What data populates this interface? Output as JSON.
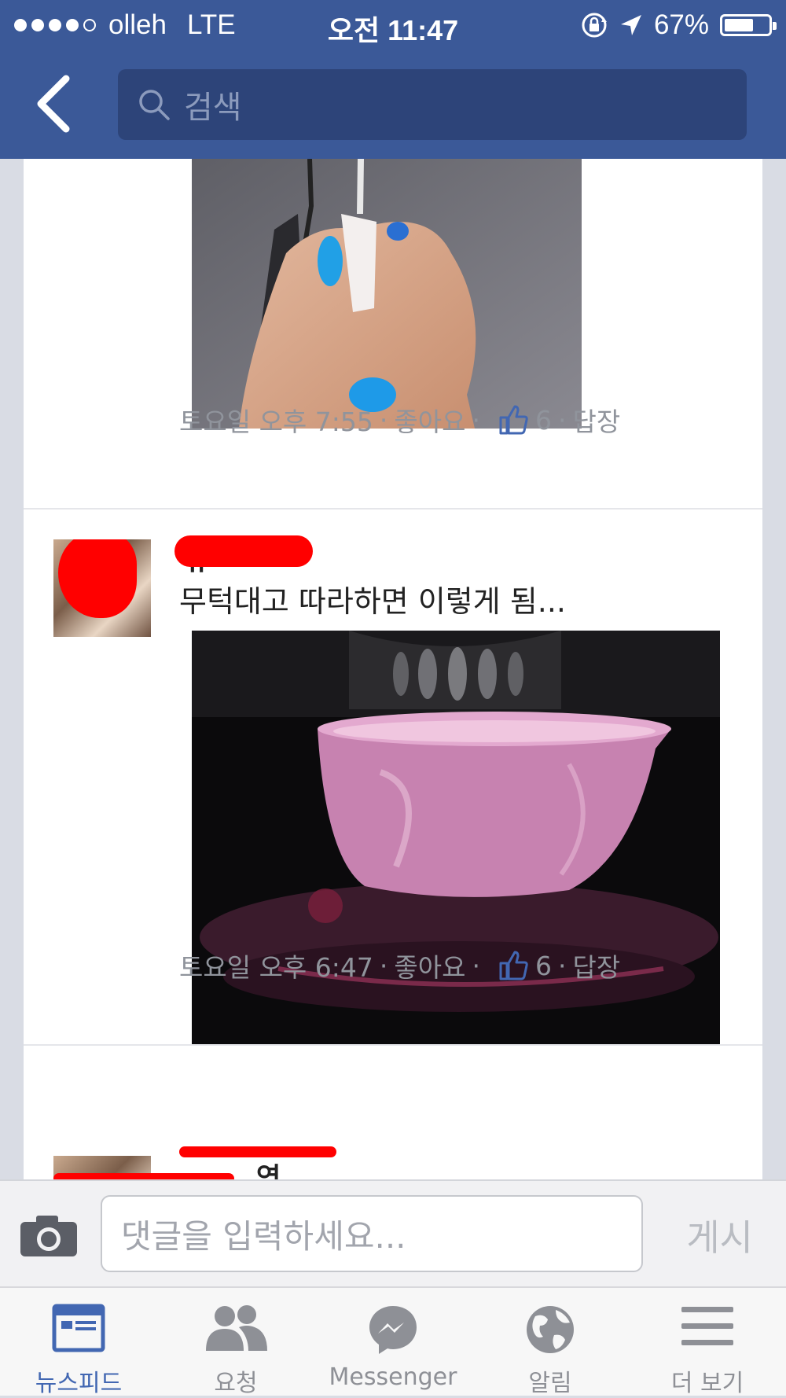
{
  "status": {
    "carrier": "olleh",
    "network": "LTE",
    "time": "오전 11:47",
    "battery": "67%",
    "battery_level": 0.67
  },
  "search": {
    "placeholder": "검색"
  },
  "comments": [
    {
      "time": "토요일 오후 7:55",
      "like_label": "좋아요",
      "like_count": "6",
      "reply_label": "답장"
    },
    {
      "author": "뀨",
      "text": "무턱대고 따라하면 이렇게 됨...",
      "time": "토요일 오후 6:47",
      "like_label": "좋아요",
      "like_count": "6",
      "reply_label": "답장"
    },
    {
      "author": "연"
    }
  ],
  "composer": {
    "placeholder": "댓글을 입력하세요...",
    "post_label": "게시"
  },
  "tabs": [
    {
      "label": "뉴스피드",
      "icon": "news-feed-icon",
      "active": true
    },
    {
      "label": "요청",
      "icon": "friend-requests-icon"
    },
    {
      "label": "Messenger",
      "icon": "messenger-icon"
    },
    {
      "label": "알림",
      "icon": "globe-notifications-icon"
    },
    {
      "label": "더 보기",
      "icon": "menu-icon"
    }
  ],
  "colors": {
    "brand": "#3b5998",
    "accent": "#4267b2",
    "redaction": "#ff0000"
  }
}
